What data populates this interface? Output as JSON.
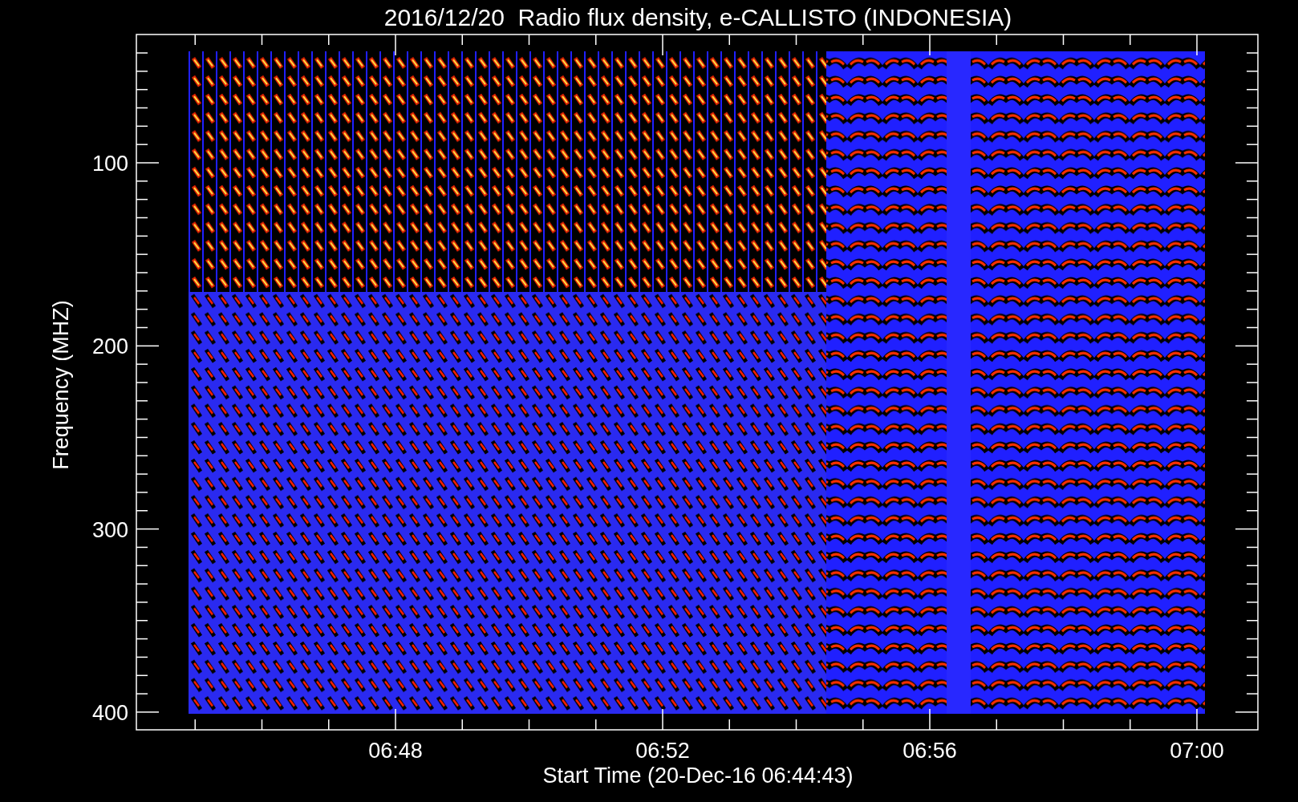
{
  "title": "2016/12/20  Radio flux density, e-CALLISTO (INDONESIA)",
  "plot": {
    "ylabel": "Frequency (MHZ)",
    "xlabel": "Start Time (20-Dec-16 06:44:43)",
    "y_tick_labels": [
      "100",
      "200",
      "300",
      "400"
    ],
    "x_tick_labels": [
      "06:48",
      "06:52",
      "06:56",
      "07:00"
    ]
  }
}
